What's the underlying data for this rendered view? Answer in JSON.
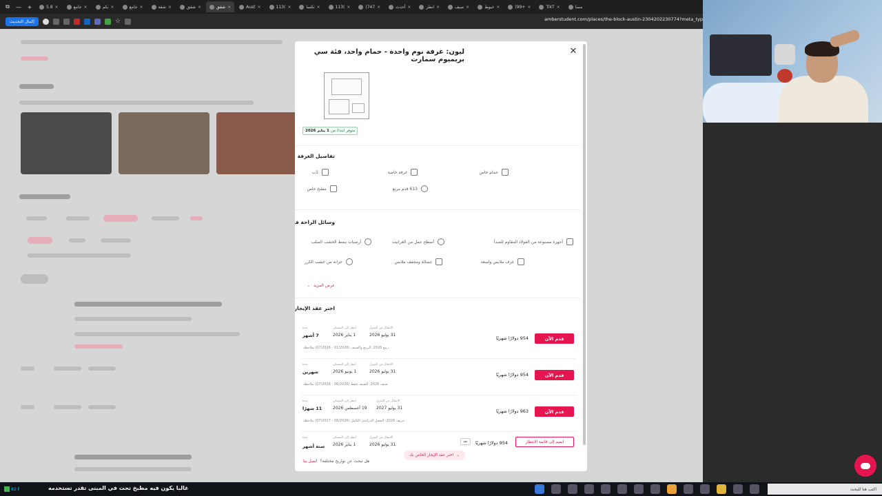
{
  "browser": {
    "tabs": [
      {
        "label": "مسا"
      },
      {
        "label": "TikT"
      },
      {
        "label": "(99+"
      },
      {
        "label": "خيوط"
      },
      {
        "label": "صيف"
      },
      {
        "label": "انظر"
      },
      {
        "label": "أحدث"
      },
      {
        "label": "(747"
      },
      {
        "label": "113("
      },
      {
        "label": "تكسا"
      },
      {
        "label": "113("
      },
      {
        "label": "Aust"
      },
      {
        "label": "شقق"
      },
      {
        "label": "شقق"
      },
      {
        "label": "شقة"
      },
      {
        "label": "جامع"
      },
      {
        "label": "بكم"
      },
      {
        "label": "جامع"
      },
      {
        "label": "5.8"
      }
    ],
    "active_tab": "شقق",
    "update_button": "إكمال التحديث",
    "url": "amberstudent.com/places/the-block-austin-2304202230774?meta_typ"
  },
  "modal": {
    "title": "ليون: غرفة نوم واحدة - حمام واحد، فئة سي بريميوم سمارت",
    "availability": {
      "label": "متوفر ابتداءً من",
      "date": "1 يناير 2026"
    },
    "room_details": {
      "heading": "تفاصيل الغرفة",
      "items": [
        {
          "label": "1ب",
          "icon": "home-icon"
        },
        {
          "label": "غرفة خاصة",
          "icon": "bed-icon"
        },
        {
          "label": "حمام خاص",
          "icon": "bath-icon"
        },
        {
          "label": "مطبخ خاص",
          "icon": "kitchen-icon"
        },
        {
          "label": "613 قدم مربع",
          "icon": "area-icon"
        }
      ]
    },
    "amenities": {
      "heading": "وسائل الراحة في الشقة",
      "items": [
        {
          "label": "أرضيات بنمط الخشب الصلب",
          "icon": "check-circle-icon"
        },
        {
          "label": "أسطح عمل من الغرانيت",
          "icon": "check-circle-icon"
        },
        {
          "label": "أجهزة مصنوعة من الفولاذ المقاوم للصدأ",
          "icon": "appliance-icon"
        },
        {
          "label": "خزانة من خشب الكرز",
          "icon": "check-circle-icon"
        },
        {
          "label": "غسالة ومجفف ملابس",
          "icon": "washer-icon"
        },
        {
          "label": "غرف ملابس واسعة",
          "icon": "closet-icon"
        }
      ],
      "show_more": "عرض المزيد"
    },
    "leases_heading": "اختر عقد الإيجار الخاص بك",
    "labels": {
      "duration": "مدة",
      "move_in": "انتقل إلى المسكن",
      "move_out": "الانتقال من المنزل"
    },
    "leases": [
      {
        "duration": "7 أشهر",
        "move_in": "1 يناير 2026",
        "move_out": "31 يوليو 2026",
        "note": "ربيع 2026: الربيع والصيف (01/2026 - 07/2026) ملاحظة",
        "price": "954 دولارًا شهريًا",
        "action": "قدم الآن"
      },
      {
        "duration": "شهرين",
        "move_in": "1 يونيو 2026",
        "move_out": "31 يوليو 2026",
        "note": "صيف 2026: الصيف فقط (06/2026 - 07/2026) ملاحظة",
        "price": "954 دولارًا شهريًا",
        "action": "قدم الآن"
      },
      {
        "duration": "11 شهرًا",
        "move_in": "19 أغسطس 2026",
        "move_out": "31 يوليو 2027",
        "note": "خريف 2026: الفصل الدراسي الكامل (08/2026 - 07/2027) ملاحظة",
        "price": "963 دولارًا شهريًا",
        "action": "قدم الآن"
      },
      {
        "duration": "ستة أشهر",
        "move_in": "1 يناير 2026",
        "move_out": "31 يوليو 2026",
        "note": "",
        "price": "954 دولارًا شهريًا",
        "badge": "نقد",
        "action": "انضم إلى قائمة الانتظار"
      }
    ],
    "choose_pill": "اختر عقد الإيجار الخاص بك",
    "footer_question": "هل تبحث عن تواريخ مختلفة؟",
    "footer_link": "اتصل بنا"
  },
  "taskbar": {
    "ticker": "غالبا يكون فيه مطبخ تحت في المبنى تقدر تستخدمه",
    "weather_temp": "82 F",
    "search_placeholder": "اكتب هنا للبحث"
  },
  "colors": {
    "accent": "#e5164f",
    "modal_bg": "#ffffff",
    "overlay": "#d6d6d6"
  }
}
